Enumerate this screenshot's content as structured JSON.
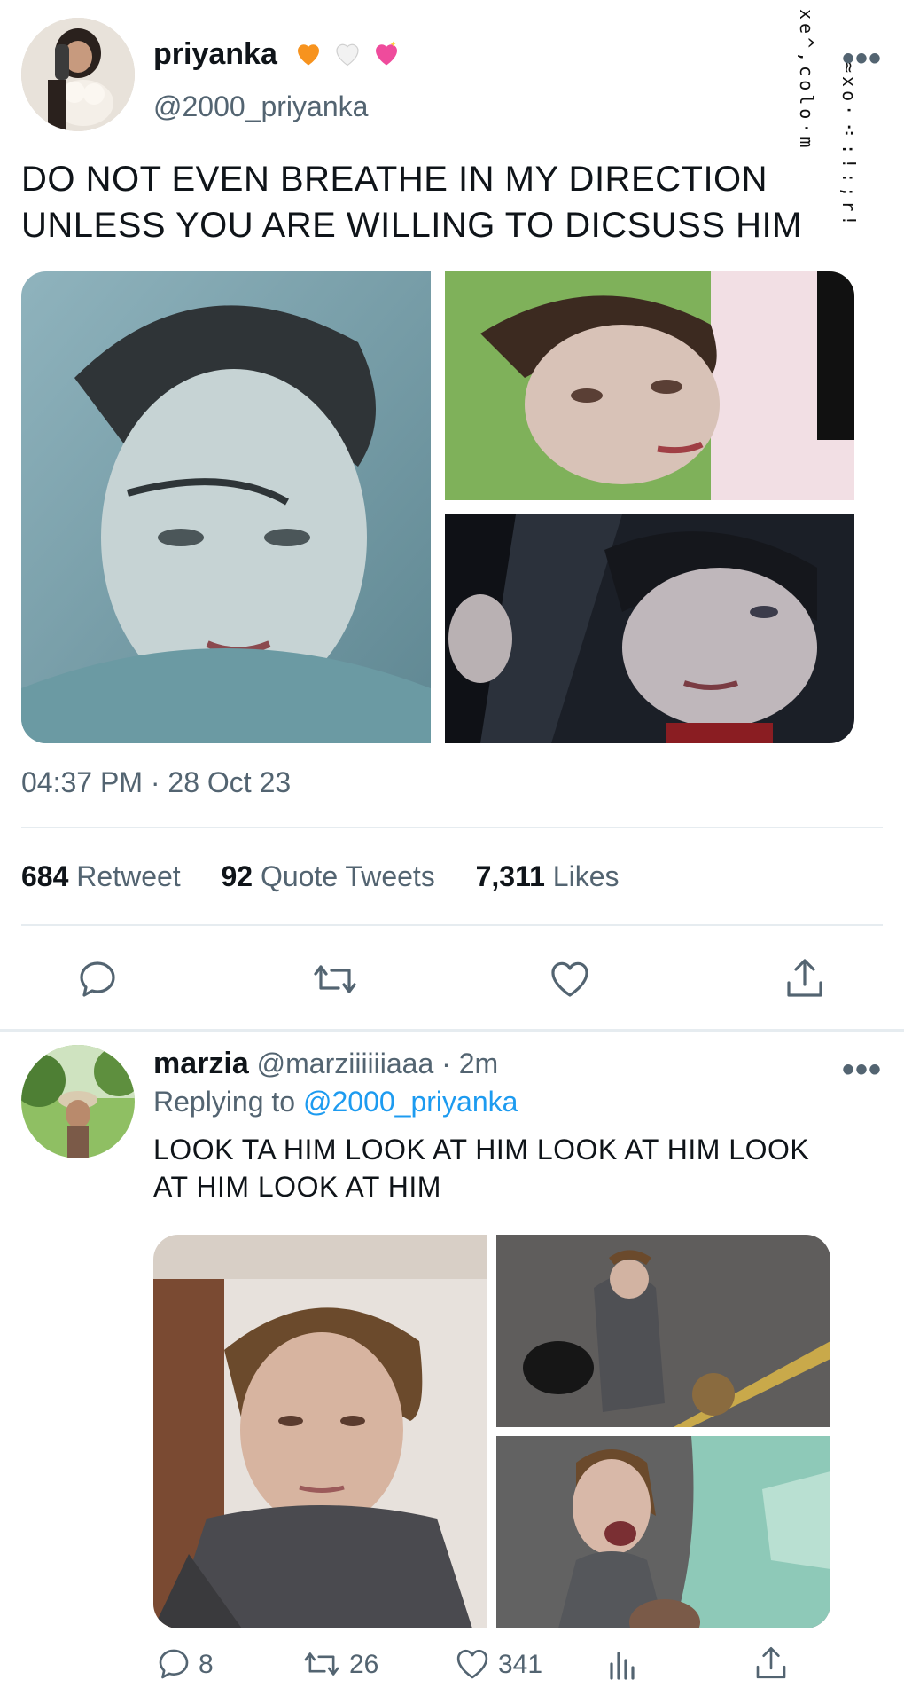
{
  "tweet": {
    "name": "priyanka",
    "emojis": [
      "orange-heart",
      "white-heart",
      "sparkling-heart"
    ],
    "handle": "@2000_priyanka",
    "text_line1": "DO NOT EVEN BREATHE IN MY DIRECTION",
    "text_line2": "UNLESS YOU ARE WILLING TO DICSUSS HIM",
    "timestamp": "04:37 PM · 28 Oct 23",
    "stats": {
      "retweets": "684",
      "retweets_label": "Retweet",
      "quotes": "92",
      "quotes_label": "Quote Tweets",
      "likes": "7,311",
      "likes_label": "Likes"
    }
  },
  "reply": {
    "name": "marzia",
    "handle": "@marziiiiiiaaa",
    "time": "· 2m",
    "replying_prefix": "Replying to",
    "replying_to": "@2000_priyanka",
    "text_line1": "LOOK TA HIM LOOK AT HIM LOOK AT HIM LOOK",
    "text_line2": "AT HIM LOOK AT HIM",
    "counts": {
      "replies": "8",
      "retweets": "26",
      "likes": "341"
    }
  },
  "colors": {
    "accent": "#1d9bf0",
    "muted": "#536471",
    "text": "#0f1419",
    "divider": "#e6ecf0"
  }
}
